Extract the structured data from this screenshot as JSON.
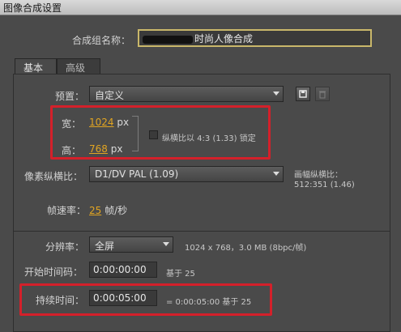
{
  "window": {
    "title": "图像合成设置"
  },
  "comp_name": {
    "label": "合成组名称：",
    "value": "时尚人像合成"
  },
  "tabs": [
    {
      "label": "基本"
    },
    {
      "label": "高级"
    }
  ],
  "preset": {
    "label": "预置：",
    "value": "自定义"
  },
  "width": {
    "label": "宽：",
    "value": "1024",
    "unit": "px"
  },
  "height": {
    "label": "高：",
    "value": "768",
    "unit": "px"
  },
  "aspect_lock": {
    "label": "纵横比以 4:3 (1.33) 锁定",
    "checked": false
  },
  "pixel_aspect": {
    "label": "像素纵横比：",
    "value": "D1/DV PAL (1.09)",
    "info_label": "画幅纵横比：",
    "info_value": "512:351 (1.46)"
  },
  "frame_rate": {
    "label": "帧速率：",
    "value": "25",
    "unit": "帧/秒"
  },
  "resolution": {
    "label": "分辨率：",
    "value": "全屏",
    "info": "1024 x 768，3.0 MB (8bpc/帧)"
  },
  "start_timecode": {
    "label": "开始时间码：",
    "value": "0:00:00:00",
    "note": "基于 25"
  },
  "duration": {
    "label": "持续时间：",
    "value": "0:00:05:00",
    "note": "= 0:00:05:00  基于 25"
  },
  "colors": {
    "highlight": "#d4202a",
    "accent_number": "#e0a422",
    "panel_bg": "#4a4a4a"
  }
}
